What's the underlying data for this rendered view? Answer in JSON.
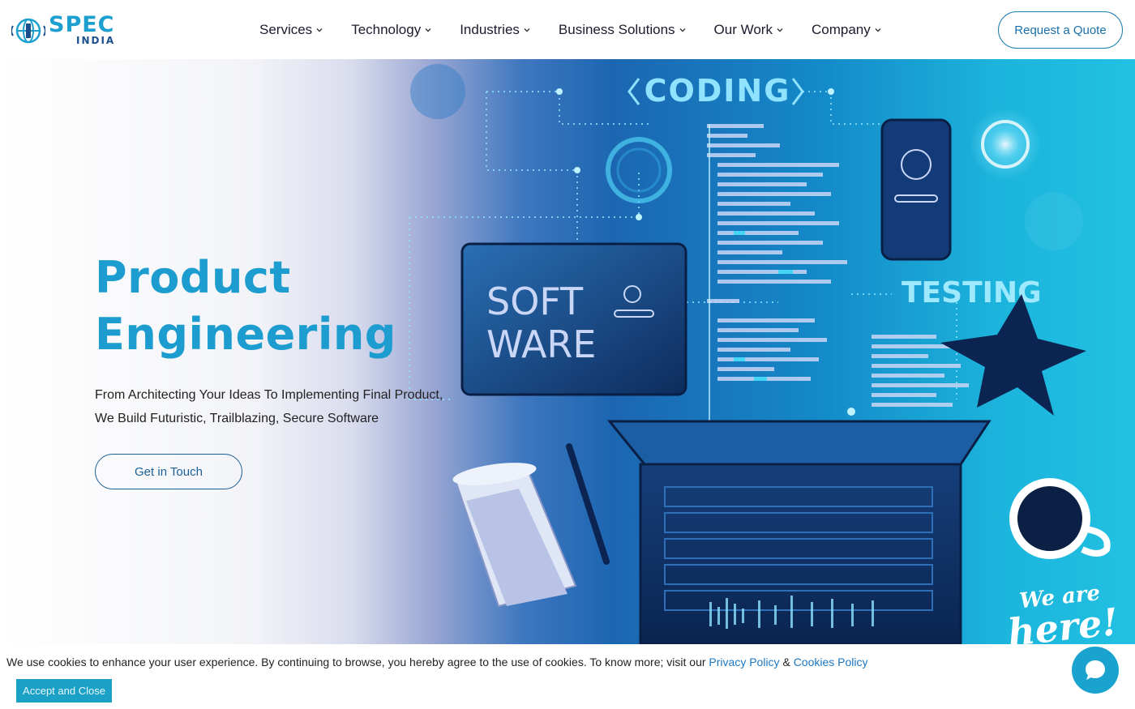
{
  "brand": {
    "name_top": "SPEC",
    "name_bottom": "INDIA",
    "primary_color": "#1d9fd0",
    "dark_color": "#1a4e8c"
  },
  "nav": {
    "items": [
      {
        "label": "Services"
      },
      {
        "label": "Technology"
      },
      {
        "label": "Industries"
      },
      {
        "label": "Business Solutions"
      },
      {
        "label": "Our Work"
      },
      {
        "label": "Company"
      }
    ],
    "quote_button": "Request a Quote"
  },
  "hero": {
    "title_line1": "Product",
    "title_line2": "Engineering",
    "subtitle_line1": "From Architecting Your Ideas To Implementing Final Product,",
    "subtitle_line2": "We Build Futuristic, Trailblazing, Secure Software",
    "cta_label": "Get in Touch",
    "art_labels": {
      "coding": "CODING",
      "software_line1": "SOFT",
      "software_line2": "WARE",
      "testing": "TESTING"
    },
    "badge_line1": "We are",
    "badge_line2": "here!"
  },
  "cookie": {
    "text": "We use cookies to enhance your user experience. By continuing to browse, you hereby agree to the use of cookies. To know more; visit our ",
    "privacy_link": "Privacy Policy",
    "amp": " & ",
    "cookies_link": "Cookies Policy",
    "accept_label": "Accept and Close"
  },
  "icons": {
    "chevron": "chevron-down-icon",
    "chat": "chat-bubble-icon"
  }
}
